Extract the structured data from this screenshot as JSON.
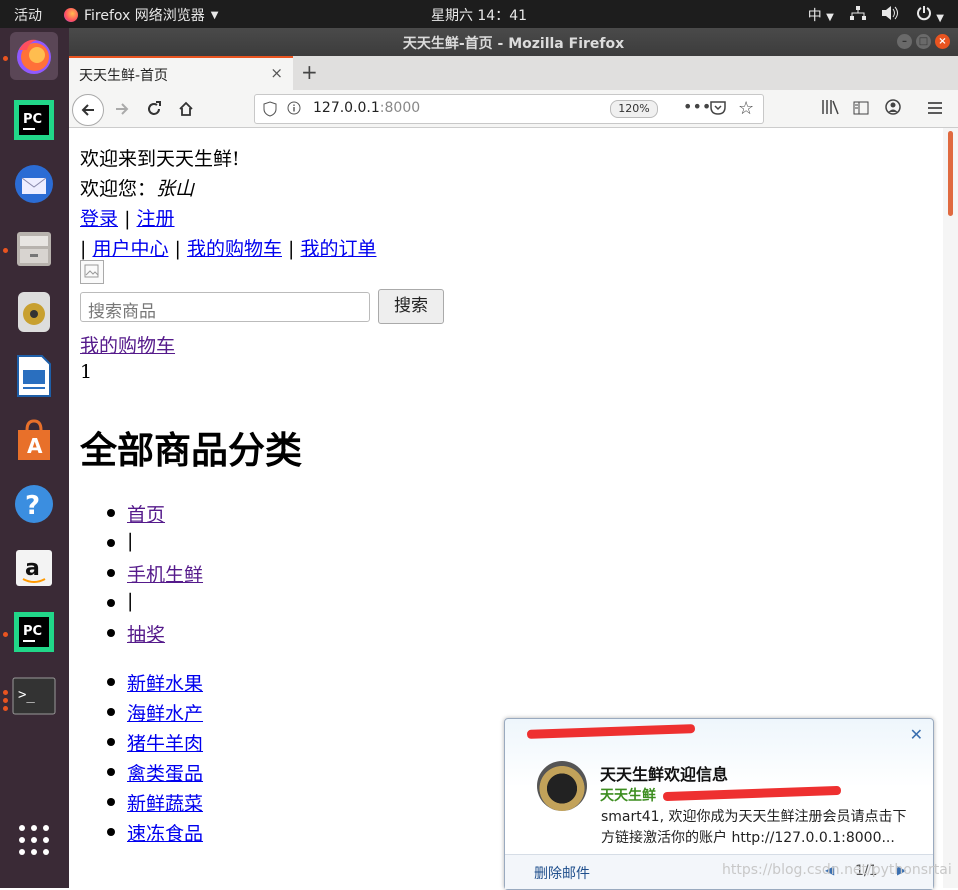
{
  "topbar": {
    "activities": "活动",
    "app_name": "Firefox 网络浏览器",
    "clock": "星期六 14：41",
    "input_method": "中"
  },
  "window": {
    "title": "天天生鲜-首页 - Mozilla Firefox"
  },
  "dock": {
    "items": [
      "firefox",
      "pycharm",
      "thunderbird",
      "files",
      "rhythmbox",
      "libreoffice-impress",
      "ubuntu-software",
      "help",
      "amazon",
      "pycharm-2",
      "terminal",
      "show-apps"
    ]
  },
  "tab": {
    "label": "天天生鲜-首页",
    "close": "×"
  },
  "nav": {
    "url_host": "127.0.0.1",
    "url_port": ":8000",
    "zoom": "120%"
  },
  "page": {
    "welcome": "欢迎来到天天生鲜!",
    "greeting_prefix": "欢迎您：",
    "user_name": "张山",
    "login": "登录",
    "sep": "|",
    "register": "注册",
    "user_center": "用户中心",
    "my_cart": "我的购物车",
    "my_orders": "我的订单",
    "search_placeholder": "搜索商品",
    "search_button": "搜索",
    "cart_link": "我的购物车",
    "cart_count": "1",
    "heading": "全部商品分类",
    "nav_items": [
      "首页",
      "|",
      "手机生鲜",
      "|",
      "抽奖"
    ],
    "categories": [
      "新鲜水果",
      "海鲜水产",
      "猪牛羊肉",
      "禽类蛋品",
      "新鲜蔬菜",
      "速冻食品"
    ]
  },
  "notification": {
    "title": "天天生鲜欢迎信息",
    "sender": "天天生鲜",
    "body": "smart41, 欢迎你成为天天生鲜注册会员请点击下方链接激活你的账户 http://127.0.0.1:8000...",
    "delete": "删除邮件",
    "pager": "1/1",
    "close": "✕"
  },
  "watermark": "https://blog.csdn.net/pythonsrtai"
}
